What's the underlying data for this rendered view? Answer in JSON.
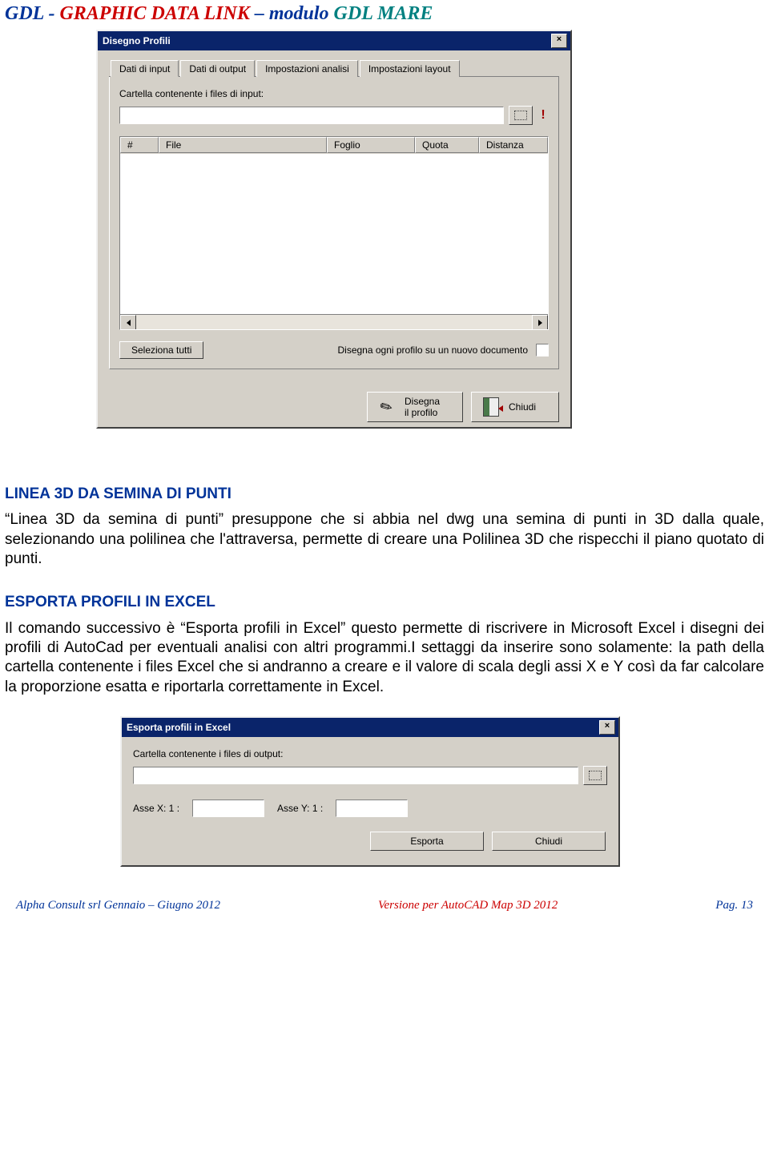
{
  "header": {
    "part1": "GDL",
    "dash": " - ",
    "part2": "GRAPHIC",
    "part3": "DATA",
    "part4": "LINK",
    "endash": " – ",
    "part5": "modulo",
    "part6": "GDL MARE"
  },
  "dialog1": {
    "title": "Disegno Profili",
    "close": "×",
    "tabs": [
      "Dati di input",
      "Dati di output",
      "Impostazioni analisi",
      "Impostazioni layout"
    ],
    "active_tab_index": 0,
    "input_folder_label": "Cartella contenente i files di input:",
    "input_folder_value": "",
    "columns": [
      "#",
      "File",
      "Foglio",
      "Quota",
      "Distanza"
    ],
    "select_all_btn": "Seleziona tutti",
    "each_doc_label": "Disegna ogni profilo su un nuovo documento",
    "each_doc_checked": false,
    "draw_btn_line1": "Disegna",
    "draw_btn_line2": "il profilo",
    "close_btn": "Chiudi"
  },
  "section1": {
    "title": "LINEA 3D DA SEMINA DI PUNTI",
    "body": "“Linea 3D da semina di punti” presuppone che si abbia nel dwg una semina di punti in 3D dalla quale, selezionando una polilinea che l'attraversa, permette di creare una Polilinea 3D che rispecchi il piano quotato di punti."
  },
  "section2": {
    "title": "ESPORTA PROFILI IN EXCEL",
    "body": "Il comando successivo è “Esporta profili in Excel” questo permette di riscrivere in Microsoft Excel i disegni dei profili di AutoCad per eventuali analisi con altri programmi.I settaggi da inserire sono solamente: la path della cartella contenente i files Excel che si andranno a creare e il valore di scala degli assi X e Y così da far calcolare la proporzione esatta e riportarla correttamente in Excel."
  },
  "dialog2": {
    "title": "Esporta profili in Excel",
    "close": "×",
    "output_folder_label": "Cartella contenente i files di output:",
    "output_folder_value": "",
    "axis_x_label": "Asse X:    1 :",
    "axis_x_value": "",
    "axis_y_label": "Asse Y:    1 :",
    "axis_y_value": "",
    "export_btn": "Esporta",
    "close_btn": "Chiudi"
  },
  "footer": {
    "left": "Alpha Consult srl  Gennaio – Giugno  2012",
    "mid": "Versione per AutoCAD Map 3D 2012",
    "right": "Pag. 13"
  }
}
